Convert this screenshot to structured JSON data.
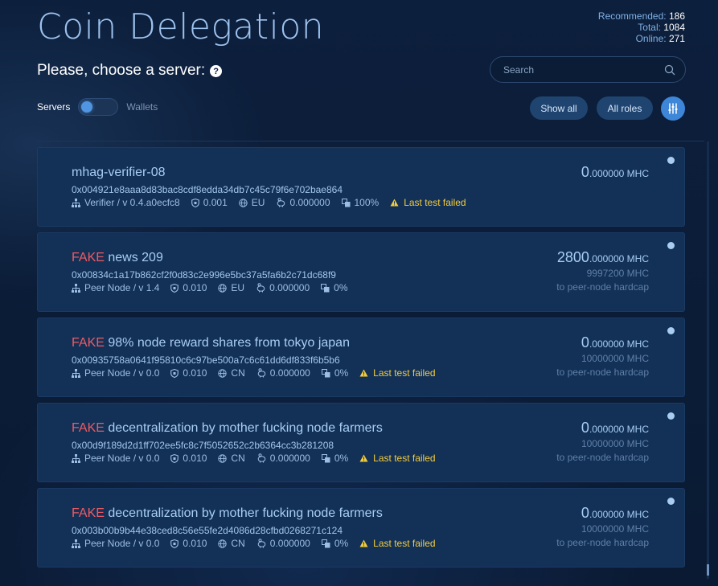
{
  "title": "Coin Delegation",
  "stats": {
    "recommended_label": "Recommended:",
    "recommended": "186",
    "total_label": "Total:",
    "total": "1084",
    "online_label": "Online:",
    "online": "271"
  },
  "subtitle": "Please, choose a server:",
  "help_glyph": "?",
  "search": {
    "placeholder": "Search"
  },
  "toggle": {
    "left": "Servers",
    "right": "Wallets"
  },
  "buttons": {
    "show_all": "Show all",
    "all_roles": "All roles"
  },
  "amount_unit": "MHC",
  "servers": [
    {
      "fake": "",
      "name": "mhag-verifier-08",
      "address": "0x004921e8aaa8d83bac8cdf8edda34db7c45c79f6e702bae864",
      "role": "Verifier / v 0.4.a0ecfc8",
      "fee": "0.001",
      "region": "EU",
      "reward": "0.000000",
      "load": "100%",
      "warning": "Last test failed",
      "amount_int": "0",
      "amount_dec": ".000000",
      "cap": "",
      "cap_note": ""
    },
    {
      "fake": "FAKE",
      "name": " news 209",
      "address": "0x00834c1a17b862cf2f0d83c2e996e5bc37a5fa6b2c71dc68f9",
      "role": "Peer Node / v 1.4",
      "fee": "0.010",
      "region": "EU",
      "reward": "0.000000",
      "load": "0%",
      "warning": "",
      "amount_int": "2800",
      "amount_dec": ".000000",
      "cap": "9997200 MHC",
      "cap_note": "to peer-node hardcap"
    },
    {
      "fake": "FAKE",
      "name": " 98% node reward shares from tokyo japan",
      "address": "0x00935758a0641f95810c6c97be500a7c6c61dd6df833f6b5b6",
      "role": "Peer Node / v 0.0",
      "fee": "0.010",
      "region": "CN",
      "reward": "0.000000",
      "load": "0%",
      "warning": "Last test failed",
      "amount_int": "0",
      "amount_dec": ".000000",
      "cap": "10000000 MHC",
      "cap_note": "to peer-node hardcap"
    },
    {
      "fake": "FAKE",
      "name": " decentralization by mother fucking node farmers",
      "address": "0x00d9f189d2d1ff702ee5fc8c7f5052652c2b6364cc3b281208",
      "role": "Peer Node / v 0.0",
      "fee": "0.010",
      "region": "CN",
      "reward": "0.000000",
      "load": "0%",
      "warning": "Last test failed",
      "amount_int": "0",
      "amount_dec": ".000000",
      "cap": "10000000 MHC",
      "cap_note": "to peer-node hardcap"
    },
    {
      "fake": "FAKE",
      "name": " decentralization by mother fucking node farmers",
      "address": "0x003b00b9b44e38ced8c56e55fe2d4086d28cfbd0268271c124",
      "role": "Peer Node / v 0.0",
      "fee": "0.010",
      "region": "CN",
      "reward": "0.000000",
      "load": "0%",
      "warning": "Last test failed",
      "amount_int": "0",
      "amount_dec": ".000000",
      "cap": "10000000 MHC",
      "cap_note": "to peer-node hardcap"
    }
  ],
  "colors": {
    "accent": "#3e87d8",
    "fake": "#ef5a63",
    "warning": "#f3cc3d",
    "card": "#133157",
    "background": "#0b1e3a"
  },
  "icons": [
    "help-icon",
    "search-icon",
    "filter-sliders-icon",
    "network-icon",
    "shield-icon",
    "globe-icon",
    "piggy-bank-icon",
    "copy-stack-icon",
    "warning-icon",
    "status-dot-icon"
  ]
}
